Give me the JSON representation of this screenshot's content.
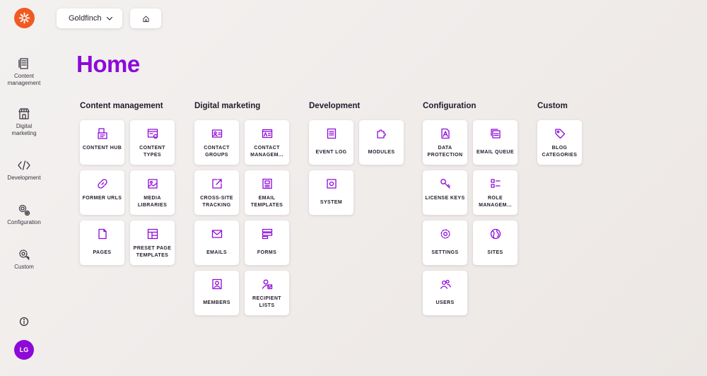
{
  "app": {
    "user_initials": "LG",
    "accent_color": "#8e09d8",
    "logo_color": "#f05a22"
  },
  "header": {
    "site_name": "Goldfinch"
  },
  "page": {
    "title": "Home"
  },
  "sidebar": {
    "items": [
      {
        "label": "Content\nmanagement",
        "icon": "content-icon"
      },
      {
        "label": "Digital\nmarketing",
        "icon": "store-icon"
      },
      {
        "label": "Development",
        "icon": "code-icon"
      },
      {
        "label": "Configuration",
        "icon": "gears-icon"
      },
      {
        "label": "Custom",
        "icon": "custom-icon"
      }
    ]
  },
  "sections": [
    {
      "title": "Content management",
      "tiles": [
        {
          "label": "CONTENT HUB",
          "icon": "content-hub-icon"
        },
        {
          "label": "CONTENT TYPES",
          "icon": "content-types-icon"
        },
        {
          "label": "FORMER URLS",
          "icon": "link-icon"
        },
        {
          "label": "MEDIA LIBRARIES",
          "icon": "media-icon"
        },
        {
          "label": "PAGES",
          "icon": "page-icon"
        },
        {
          "label": "PRESET PAGE TEMPLATES",
          "icon": "template-icon"
        }
      ]
    },
    {
      "title": "Digital marketing",
      "tiles": [
        {
          "label": "CONTACT GROUPS",
          "icon": "contact-groups-icon"
        },
        {
          "label": "CONTACT MANAGEM...",
          "icon": "contact-card-icon"
        },
        {
          "label": "CROSS-SITE TRACKING",
          "icon": "external-link-icon"
        },
        {
          "label": "EMAIL TEMPLATES",
          "icon": "email-template-icon"
        },
        {
          "label": "EMAILS",
          "icon": "envelope-icon"
        },
        {
          "label": "FORMS",
          "icon": "forms-icon"
        },
        {
          "label": "MEMBERS",
          "icon": "member-icon"
        },
        {
          "label": "RECIPIENT LISTS",
          "icon": "recipients-icon"
        }
      ]
    },
    {
      "title": "Development",
      "tiles": [
        {
          "label": "EVENT LOG",
          "icon": "log-icon"
        },
        {
          "label": "MODULES",
          "icon": "puzzle-icon"
        },
        {
          "label": "SYSTEM",
          "icon": "system-icon"
        }
      ]
    },
    {
      "title": "Configuration",
      "tiles": [
        {
          "label": "DATA PROTECTION",
          "icon": "data-protection-icon"
        },
        {
          "label": "EMAIL QUEUE",
          "icon": "email-queue-icon"
        },
        {
          "label": "LICENSE KEYS",
          "icon": "key-icon"
        },
        {
          "label": "ROLE MANAGEM...",
          "icon": "role-icon"
        },
        {
          "label": "SETTINGS",
          "icon": "gear-icon"
        },
        {
          "label": "SITES",
          "icon": "globe-icon"
        },
        {
          "label": "USERS",
          "icon": "users-icon"
        }
      ]
    },
    {
      "title": "Custom",
      "tiles": [
        {
          "label": "BLOG CATEGORIES",
          "icon": "tag-icon"
        }
      ]
    }
  ]
}
